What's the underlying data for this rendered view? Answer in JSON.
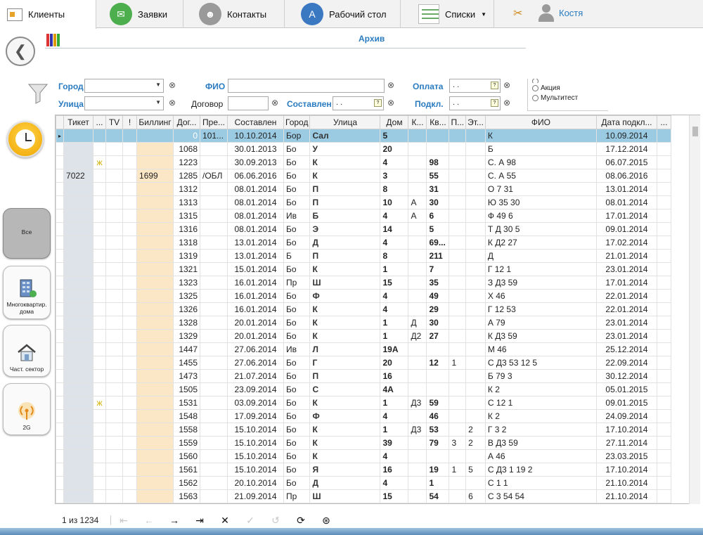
{
  "nav": {
    "tabs": [
      {
        "label": "Клиенты",
        "icon": "clients-icon"
      },
      {
        "label": "Заявки",
        "icon": "requests-icon"
      },
      {
        "label": "Контакты",
        "icon": "contacts-icon"
      },
      {
        "label": "Рабочий стол",
        "icon": "desktop-icon"
      },
      {
        "label": "Списки",
        "icon": "lists-icon"
      }
    ],
    "user": "Костя"
  },
  "archive": {
    "title": "Архив"
  },
  "filters": {
    "city": "Город",
    "street": "Улица",
    "fio": "ФИО",
    "contract": "Договор",
    "payment": "Оплата",
    "composed": "Составлен",
    "connect": "Подкл.",
    "date_placeholder": ". .",
    "radios": [
      "Акция",
      "Мультитест"
    ]
  },
  "side": {
    "all": "Все",
    "multi": "Многоквартир. дома",
    "private": "Част. сектор",
    "g2": "2G"
  },
  "table": {
    "columns": [
      "Тикет",
      "...",
      "TV",
      "!",
      "Биллинг",
      "Дог...",
      "Пре...",
      "Составлен",
      "Город",
      "Улица",
      "Дом",
      "К...",
      "Кв...",
      "П...",
      "Эт...",
      "ФИО",
      "Дата подкл...",
      "..."
    ],
    "rows": [
      {
        "ticket": "",
        "mark": "",
        "bill": "",
        "dog": "0",
        "pre": "101...",
        "date": "10.10.2014",
        "city": "Бор",
        "street": "Сал",
        "house": "5",
        "k": "",
        "flat": "",
        "p": "",
        "et": "",
        "fio": "К",
        "connect": "10.09.2014",
        "selected": true
      },
      {
        "ticket": "",
        "mark": "",
        "bill": "",
        "dog": "1068",
        "pre": "",
        "date": "30.01.2013",
        "city": "Бо",
        "street": "У",
        "house": "20",
        "k": "",
        "flat": "",
        "p": "",
        "et": "",
        "fio": "Б",
        "connect": "17.12.2014"
      },
      {
        "ticket": "",
        "mark": "ж",
        "bill": "",
        "dog": "1223",
        "pre": "",
        "date": "30.09.2013",
        "city": "Бо",
        "street": "К",
        "house": "4",
        "k": "",
        "flat": "98",
        "p": "",
        "et": "",
        "fio": "С. А 98",
        "connect": "06.07.2015"
      },
      {
        "ticket": "7022",
        "mark": "",
        "bill": "1699",
        "dog": "1285",
        "pre": "/ОБЛ",
        "date": "06.06.2016",
        "city": "Бо",
        "street": "К",
        "house": "3",
        "k": "",
        "flat": "55",
        "p": "",
        "et": "",
        "fio": "С. А 55",
        "connect": "08.06.2016"
      },
      {
        "ticket": "",
        "mark": "",
        "bill": "",
        "dog": "1312",
        "pre": "",
        "date": "08.01.2014",
        "city": "Бо",
        "street": "П",
        "house": "8",
        "k": "",
        "flat": "31",
        "p": "",
        "et": "",
        "fio": "О 7 31",
        "connect": "13.01.2014"
      },
      {
        "ticket": "",
        "mark": "",
        "bill": "",
        "dog": "1313",
        "pre": "",
        "date": "08.01.2014",
        "city": "Бо",
        "street": "П",
        "house": "10",
        "k": "А",
        "flat": "30",
        "p": "",
        "et": "",
        "fio": "Ю 35 30",
        "connect": "08.01.2014"
      },
      {
        "ticket": "",
        "mark": "",
        "bill": "",
        "dog": "1315",
        "pre": "",
        "date": "08.01.2014",
        "city": "Ив",
        "street": "Б",
        "house": "4",
        "k": "А",
        "flat": "6",
        "p": "",
        "et": "",
        "fio": "Ф 49 6",
        "connect": "17.01.2014"
      },
      {
        "ticket": "",
        "mark": "",
        "bill": "",
        "dog": "1316",
        "pre": "",
        "date": "08.01.2014",
        "city": "Бо",
        "street": "Э",
        "house": "14",
        "k": "",
        "flat": "5",
        "p": "",
        "et": "",
        "fio": "Т Д 30 5",
        "connect": "09.01.2014"
      },
      {
        "ticket": "",
        "mark": "",
        "bill": "",
        "dog": "1318",
        "pre": "",
        "date": "13.01.2014",
        "city": "Бо",
        "street": "Д",
        "house": "4",
        "k": "",
        "flat": "69...",
        "p": "",
        "et": "",
        "fio": "К Д2 27",
        "connect": "17.02.2014"
      },
      {
        "ticket": "",
        "mark": "",
        "bill": "",
        "dog": "1319",
        "pre": "",
        "date": "13.01.2014",
        "city": "Б",
        "street": "П",
        "house": "8",
        "k": "",
        "flat": "211",
        "p": "",
        "et": "",
        "fio": "Д",
        "connect": "21.01.2014"
      },
      {
        "ticket": "",
        "mark": "",
        "bill": "",
        "dog": "1321",
        "pre": "",
        "date": "15.01.2014",
        "city": "Бо",
        "street": "К",
        "house": "1",
        "k": "",
        "flat": "7",
        "p": "",
        "et": "",
        "fio": "Г 12 1",
        "connect": "23.01.2014"
      },
      {
        "ticket": "",
        "mark": "",
        "bill": "",
        "dog": "1323",
        "pre": "",
        "date": "16.01.2014",
        "city": "Пр",
        "street": "Ш",
        "house": "15",
        "k": "",
        "flat": "35",
        "p": "",
        "et": "",
        "fio": "З Д3 59",
        "connect": "17.01.2014"
      },
      {
        "ticket": "",
        "mark": "",
        "bill": "",
        "dog": "1325",
        "pre": "",
        "date": "16.01.2014",
        "city": "Бо",
        "street": "Ф",
        "house": "4",
        "k": "",
        "flat": "49",
        "p": "",
        "et": "",
        "fio": "Х 46",
        "connect": "22.01.2014"
      },
      {
        "ticket": "",
        "mark": "",
        "bill": "",
        "dog": "1326",
        "pre": "",
        "date": "16.01.2014",
        "city": "Бо",
        "street": "К",
        "house": "4",
        "k": "",
        "flat": "29",
        "p": "",
        "et": "",
        "fio": "Г 12 53",
        "connect": "22.01.2014"
      },
      {
        "ticket": "",
        "mark": "",
        "bill": "",
        "dog": "1328",
        "pre": "",
        "date": "20.01.2014",
        "city": "Бо",
        "street": "К",
        "house": "1",
        "k": "Д",
        "flat": "30",
        "p": "",
        "et": "",
        "fio": "А 79",
        "connect": "23.01.2014"
      },
      {
        "ticket": "",
        "mark": "",
        "bill": "",
        "dog": "1329",
        "pre": "",
        "date": "20.01.2014",
        "city": "Бо",
        "street": "К",
        "house": "1",
        "k": "Д2",
        "flat": "27",
        "p": "",
        "et": "",
        "fio": "К Д3 59",
        "connect": "23.01.2014"
      },
      {
        "ticket": "",
        "mark": "",
        "bill": "",
        "dog": "1447",
        "pre": "",
        "date": "27.06.2014",
        "city": "Ив",
        "street": "Л",
        "house": "19А",
        "k": "",
        "flat": "",
        "p": "",
        "et": "",
        "fio": "М 46",
        "connect": "25.12.2014"
      },
      {
        "ticket": "",
        "mark": "",
        "bill": "",
        "dog": "1455",
        "pre": "",
        "date": "27.06.2014",
        "city": "Бо",
        "street": "Г",
        "house": "20",
        "k": "",
        "flat": "12",
        "p": "1",
        "et": "",
        "fio": "С Д3 53 12 5",
        "connect": "22.09.2014"
      },
      {
        "ticket": "",
        "mark": "",
        "bill": "",
        "dog": "1473",
        "pre": "",
        "date": "21.07.2014",
        "city": "Бо",
        "street": "П",
        "house": "16",
        "k": "",
        "flat": "",
        "p": "",
        "et": "",
        "fio": "Б 79 3",
        "connect": "30.12.2014"
      },
      {
        "ticket": "",
        "mark": "",
        "bill": "",
        "dog": "1505",
        "pre": "",
        "date": "23.09.2014",
        "city": "Бо",
        "street": "С",
        "house": "4А",
        "k": "",
        "flat": "",
        "p": "",
        "et": "",
        "fio": "К 2",
        "connect": "05.01.2015"
      },
      {
        "ticket": "",
        "mark": "ж",
        "bill": "",
        "dog": "1531",
        "pre": "",
        "date": "03.09.2014",
        "city": "Бо",
        "street": "К",
        "house": "1",
        "k": "Д3",
        "flat": "59",
        "p": "",
        "et": "",
        "fio": "С 12 1",
        "connect": "09.01.2015"
      },
      {
        "ticket": "",
        "mark": "",
        "bill": "",
        "dog": "1548",
        "pre": "",
        "date": "17.09.2014",
        "city": "Бо",
        "street": "Ф",
        "house": "4",
        "k": "",
        "flat": "46",
        "p": "",
        "et": "",
        "fio": "К 2",
        "connect": "24.09.2014"
      },
      {
        "ticket": "",
        "mark": "",
        "bill": "",
        "dog": "1558",
        "pre": "",
        "date": "15.10.2014",
        "city": "Бо",
        "street": "К",
        "house": "1",
        "k": "Д3",
        "flat": "53",
        "p": "",
        "et": "2",
        "fio": "Г 3 2",
        "connect": "17.10.2014"
      },
      {
        "ticket": "",
        "mark": "",
        "bill": "",
        "dog": "1559",
        "pre": "",
        "date": "15.10.2014",
        "city": "Бо",
        "street": "К",
        "house": "39",
        "k": "",
        "flat": "79",
        "p": "3",
        "et": "2",
        "fio": "В Д3 59",
        "connect": "27.11.2014"
      },
      {
        "ticket": "",
        "mark": "",
        "bill": "",
        "dog": "1560",
        "pre": "",
        "date": "15.10.2014",
        "city": "Бо",
        "street": "К",
        "house": "4",
        "k": "",
        "flat": "",
        "p": "",
        "et": "",
        "fio": "А 46",
        "connect": "23.03.2015"
      },
      {
        "ticket": "",
        "mark": "",
        "bill": "",
        "dog": "1561",
        "pre": "",
        "date": "15.10.2014",
        "city": "Бо",
        "street": "Я",
        "house": "16",
        "k": "",
        "flat": "19",
        "p": "1",
        "et": "5",
        "fio": "С Д3 1 19 2",
        "connect": "17.10.2014"
      },
      {
        "ticket": "",
        "mark": "",
        "bill": "",
        "dog": "1562",
        "pre": "",
        "date": "20.10.2014",
        "city": "Бо",
        "street": "Д",
        "house": "4",
        "k": "",
        "flat": "1",
        "p": "",
        "et": "",
        "fio": "С 1 1",
        "connect": "21.10.2014"
      },
      {
        "ticket": "",
        "mark": "",
        "bill": "",
        "dog": "1563",
        "pre": "",
        "date": "21.09.2014",
        "city": "Пр",
        "street": "Ш",
        "house": "15",
        "k": "",
        "flat": "54",
        "p": "",
        "et": "6",
        "fio": "С 3 54 54",
        "connect": "21.10.2014"
      }
    ]
  },
  "pager": {
    "count": "1 из 1234"
  }
}
